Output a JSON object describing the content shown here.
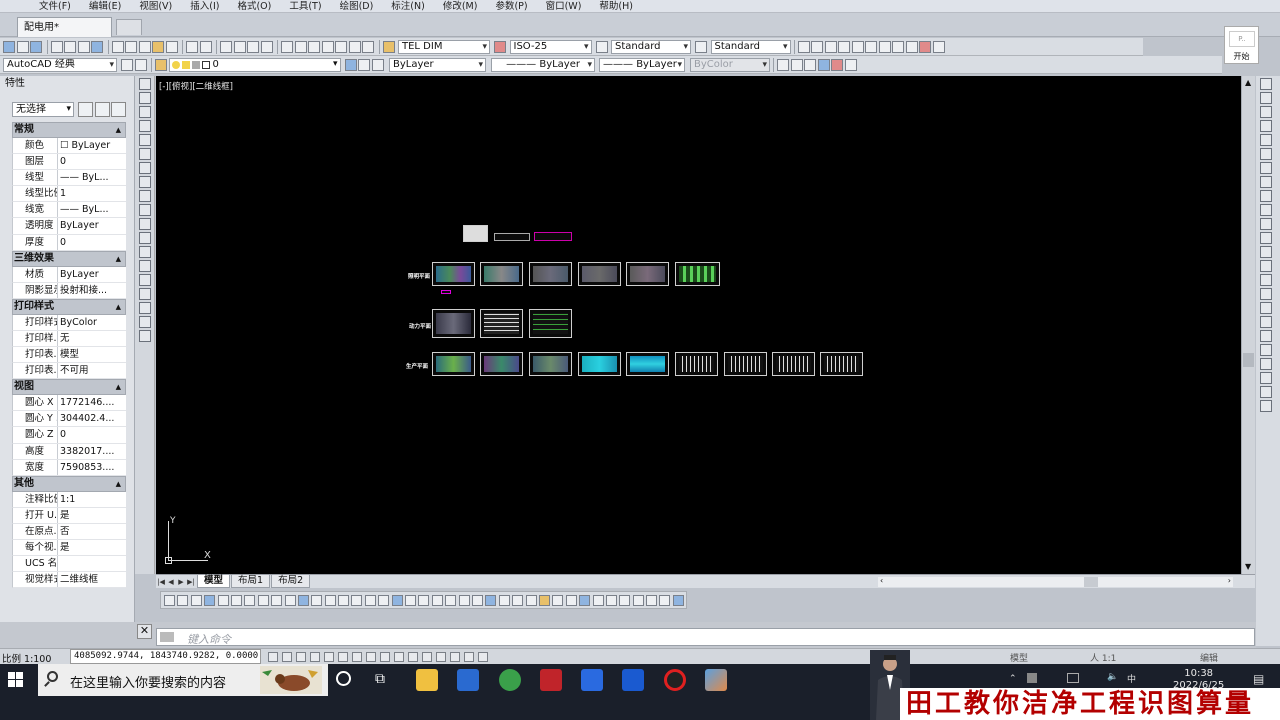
{
  "menu": [
    "文件(F)",
    "编辑(E)",
    "视图(V)",
    "插入(I)",
    "格式(O)",
    "工具(T)",
    "绘图(D)",
    "标注(N)",
    "修改(M)",
    "参数(P)",
    "窗口(W)",
    "帮助(H)"
  ],
  "doc_tab": "配电用*",
  "start_button": "开始",
  "toolbar": {
    "text_style": "TEL DIM",
    "dim_style": "ISO-25",
    "table_style": "Standard",
    "mleader_style": "Standard",
    "workspace": "AutoCAD 经典",
    "layer": "0",
    "color": "ByLayer",
    "linetype": "ByLayer",
    "lineweight": "ByLayer",
    "plotstyle": "ByColor"
  },
  "properties": {
    "title": "特性",
    "selection": "无选择",
    "groups": [
      {
        "name": "常规",
        "rows": [
          [
            "颜色",
            "☐ ByLayer"
          ],
          [
            "图层",
            "0"
          ],
          [
            "线型",
            "—— ByL..."
          ],
          [
            "线型比例",
            "1"
          ],
          [
            "线宽",
            "—— ByL..."
          ],
          [
            "透明度",
            "ByLayer"
          ],
          [
            "厚度",
            "0"
          ]
        ]
      },
      {
        "name": "三维效果",
        "rows": [
          [
            "材质",
            "ByLayer"
          ],
          [
            "阴影显示",
            "投射和接..."
          ]
        ]
      },
      {
        "name": "打印样式",
        "rows": [
          [
            "打印样式",
            "ByColor"
          ],
          [
            "打印样...",
            "无"
          ],
          [
            "打印表...",
            "模型"
          ],
          [
            "打印表...",
            "不可用"
          ]
        ]
      },
      {
        "name": "视图",
        "rows": [
          [
            "圆心 X ...",
            "1772146...."
          ],
          [
            "圆心 Y ...",
            "304402.4..."
          ],
          [
            "圆心 Z ...",
            "0"
          ],
          [
            "高度",
            "3382017...."
          ],
          [
            "宽度",
            "7590853...."
          ]
        ]
      },
      {
        "name": "其他",
        "rows": [
          [
            "注释比例",
            "1:1"
          ],
          [
            "打开 U...",
            "是"
          ],
          [
            "在原点...",
            "否"
          ],
          [
            "每个视...",
            "是"
          ],
          [
            "UCS 名称",
            ""
          ],
          [
            "视觉样式",
            "二维线框"
          ]
        ]
      }
    ]
  },
  "viewport": {
    "label": "[-][俯视][二维线框]",
    "row_labels": [
      "照明平面",
      "动力平面",
      "生产平面"
    ],
    "ucs_x": "X",
    "ucs_y": "Y"
  },
  "layout_tabs": [
    "模型",
    "布局1",
    "布局2"
  ],
  "command": {
    "placeholder": "键入命令"
  },
  "status": {
    "scale": "比例 1:100",
    "coords": "4085092.9744, 1843740.9282, 0.0000",
    "model": "模型",
    "annotation": "人 1:1",
    "edit": "编辑"
  },
  "taskbar": {
    "search": "在这里输入你要搜索的内容",
    "time": "10:38",
    "date": "2022/6/25"
  },
  "watermark": "田工教你洁净工程识图算量"
}
